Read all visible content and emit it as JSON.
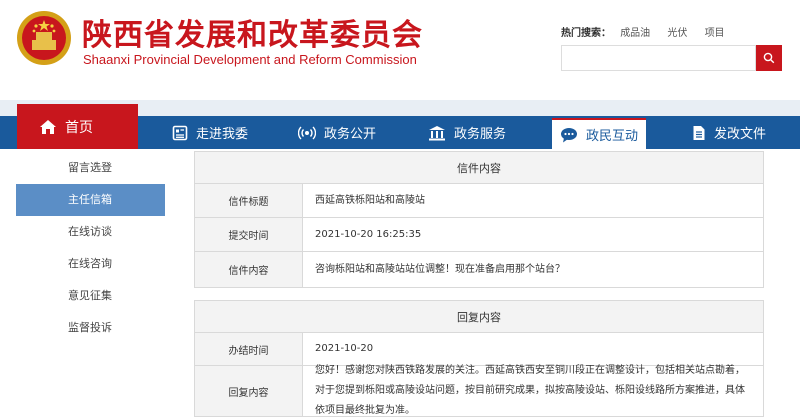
{
  "header": {
    "site_title": "陕西省发展和改革委员会",
    "site_subtitle": "Shaanxi Provincial Development and Reform Commission",
    "hot_search_label": "热门搜索：",
    "hot_keywords": [
      "成品油",
      "光伏",
      "项目"
    ],
    "search_placeholder": "",
    "search_icon": "search-icon"
  },
  "nav": {
    "home": "首页",
    "items": [
      {
        "label": "走进我委",
        "icon": "id-card-icon"
      },
      {
        "label": "政务公开",
        "icon": "broadcast-icon"
      },
      {
        "label": "政务服务",
        "icon": "building-icon"
      },
      {
        "label": "政民互动",
        "icon": "chat-icon",
        "active": true
      },
      {
        "label": "发改文件",
        "icon": "document-icon"
      }
    ]
  },
  "sidebar": {
    "items": [
      {
        "label": "留言选登"
      },
      {
        "label": "主任信箱",
        "active": true
      },
      {
        "label": "在线访谈"
      },
      {
        "label": "在线咨询"
      },
      {
        "label": "意见征集"
      },
      {
        "label": "监督投诉"
      }
    ]
  },
  "letter": {
    "heading": "信件内容",
    "rows": [
      {
        "label": "信件标题",
        "value": "西延高铁栎阳站和高陵站"
      },
      {
        "label": "提交时间",
        "value": "2021-10-20 16:25:35"
      },
      {
        "label": "信件内容",
        "value": "咨询栎阳站和高陵站站位调整！现在准备启用那个站台？"
      }
    ]
  },
  "reply": {
    "heading": "回复内容",
    "rows": [
      {
        "label": "办结时间",
        "value": "2021-10-20"
      },
      {
        "label": "回复内容",
        "value": "您好！感谢您对陕西铁路发展的关注。西延高铁西安至铜川段正在调整设计，包括相关站点勘着，对于您提到栎阳或高陵设站问题，按目前研究成果，拟按高陵设站、栎阳设线路所方案推进，具体依项目最终批复为准。"
      }
    ]
  },
  "colors": {
    "brand_red": "#c8161d",
    "nav_blue": "#1a5a9c",
    "sidebar_active": "#5b8ec6"
  }
}
